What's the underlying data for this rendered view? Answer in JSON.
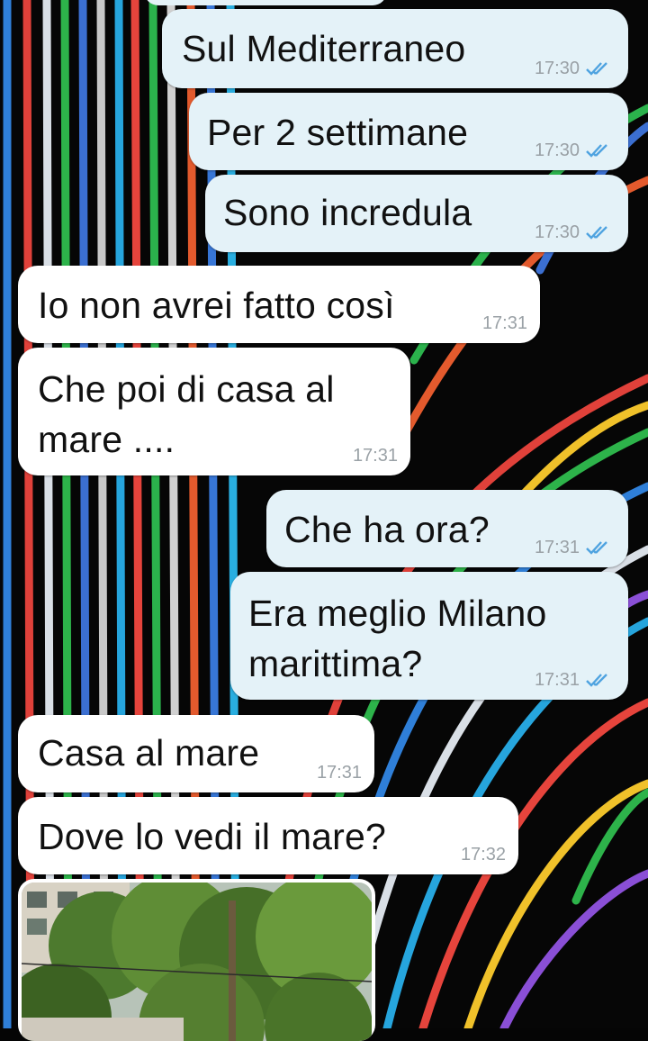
{
  "messages": [
    {
      "text": "Sul Mediterraneo",
      "time": "17:30",
      "dir": "out"
    },
    {
      "text": "Per 2 settimane",
      "time": "17:30",
      "dir": "out"
    },
    {
      "text": "Sono incredula",
      "time": "17:30",
      "dir": "out"
    },
    {
      "text": "Io non avrei fatto così",
      "time": "17:31",
      "dir": "in"
    },
    {
      "text_line1": "Che poi di casa al",
      "text_line2": "mare ....",
      "time": "17:31",
      "dir": "in"
    },
    {
      "text": "Che ha ora?",
      "time": "17:31",
      "dir": "out"
    },
    {
      "text_line1": "Era meglio Milano",
      "text_line2": "marittima?",
      "time": "17:31",
      "dir": "out"
    },
    {
      "text": "Casa al mare",
      "time": "17:31",
      "dir": "in"
    },
    {
      "text": "Dove lo vedi il mare?",
      "time": "17:32",
      "dir": "in"
    }
  ],
  "photo_message": {
    "dir": "in",
    "icon": "image-thumbnail"
  },
  "colors": {
    "outgoing_bubble": "#e4f2f8",
    "incoming_bubble": "#ffffff",
    "read_ticks": "#4fa3e0",
    "time_text": "#9aa1a6"
  }
}
